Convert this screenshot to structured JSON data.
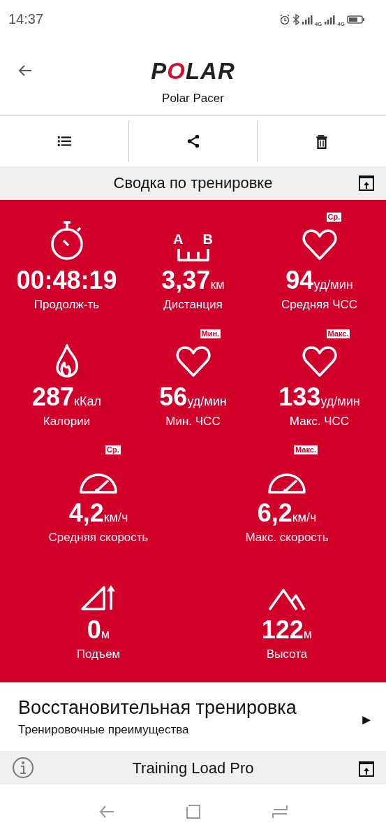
{
  "status_bar": {
    "time": "14:37",
    "network_labels": [
      "4G",
      "4G"
    ]
  },
  "header": {
    "logo": "POLAR",
    "subtitle": "Polar Pacer"
  },
  "toolbar": [
    {
      "kind": "list"
    },
    {
      "kind": "share"
    },
    {
      "kind": "delete"
    }
  ],
  "summary": {
    "title": "Сводка по тренировке",
    "rows": [
      [
        {
          "kind": "stopwatch",
          "value": "00:48:19",
          "label": "Продолж-ть"
        },
        {
          "kind": "distance",
          "icon_texts": [
            "A",
            "B"
          ],
          "value": "3,37",
          "unit": "км",
          "label": "Дистанция"
        },
        {
          "kind": "heart",
          "badge": "Ср.",
          "value": "94",
          "unit": "уд/мин",
          "label": "Средняя ЧСС"
        }
      ],
      [
        {
          "kind": "flame",
          "value": "287",
          "unit": "кКал",
          "label": "Калории"
        },
        {
          "kind": "heart",
          "badge": "Мин.",
          "value": "56",
          "unit": "уд/мин",
          "label": "Мин. ЧСС"
        },
        {
          "kind": "heart",
          "badge": "Макс.",
          "value": "133",
          "unit": "уд/мин",
          "label": "Макс. ЧСС"
        }
      ],
      [
        {
          "kind": "speed",
          "badge": "Ср.",
          "value": "4,2",
          "unit": "км/ч",
          "label": "Средняя скорость"
        },
        {
          "kind": "speed",
          "badge": "Макс.",
          "value": "6,2",
          "unit": "км/ч",
          "label": "Макс. скорость"
        }
      ],
      [
        {
          "kind": "ascent",
          "value": "0",
          "unit": "м",
          "label": "Подъем"
        },
        {
          "kind": "mountain",
          "value": "122",
          "unit": "м",
          "label": "Высота"
        }
      ]
    ]
  },
  "benefit": {
    "title": "Восстановительная тренировка",
    "subtitle": "Тренировочные преимущества",
    "arrow": "►"
  },
  "training_load": {
    "title": "Training Load Pro"
  }
}
